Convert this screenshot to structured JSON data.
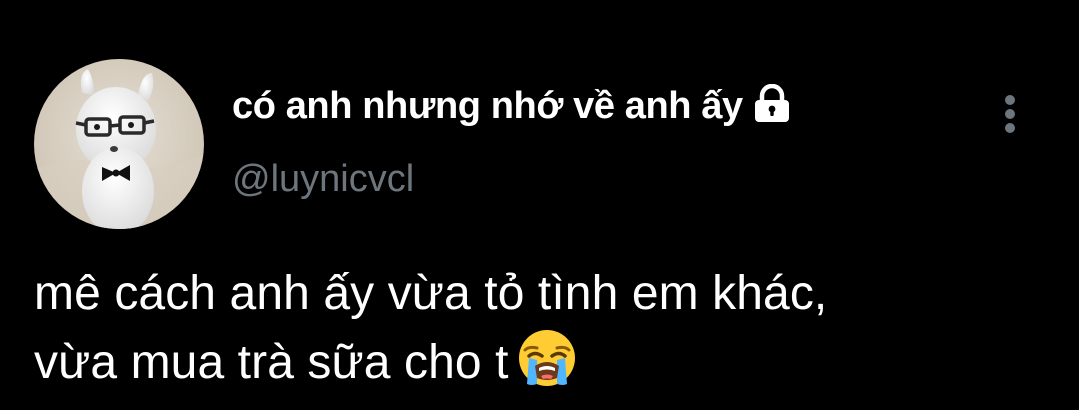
{
  "profile": {
    "display_name": "có anh nhưng nhớ về anh ấy",
    "handle": "@luynicvcl",
    "protected_icon": "lock-icon",
    "avatar_icon": "alpaca-plush-avatar"
  },
  "menu": {
    "icon": "more-vertical-icon"
  },
  "tweet": {
    "line1": "mê cách anh ấy vừa tỏ tình em khác,",
    "line2": "vừa mua trà sữa cho t",
    "emoji": "loudly-crying-face-icon"
  },
  "colors": {
    "background": "#000000",
    "text_primary": "#ffffff",
    "text_secondary": "#6e767d"
  }
}
